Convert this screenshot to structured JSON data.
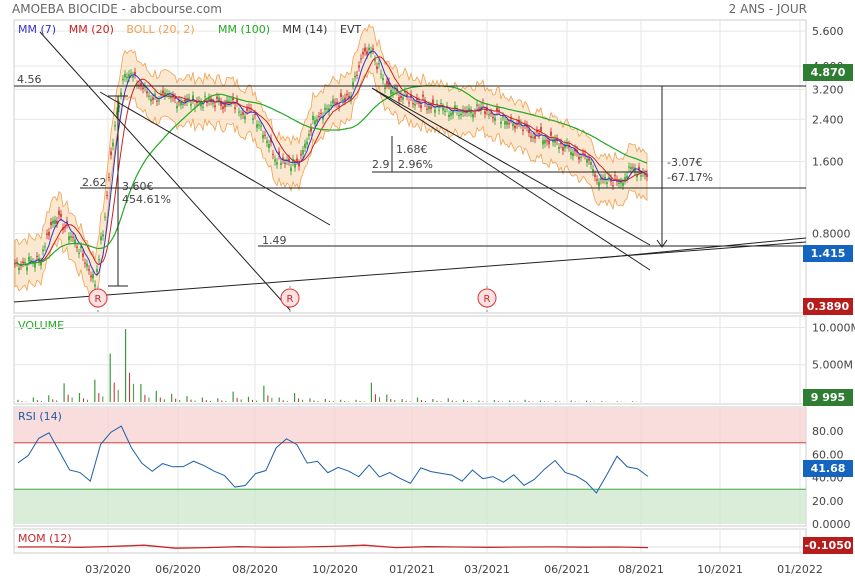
{
  "header": {
    "title": "AMOEBA BIOCIDE - abcbourse.com",
    "period": "2 ANS - JOUR"
  },
  "legend": [
    {
      "text": "MM (7)",
      "color": "#3333cc"
    },
    {
      "text": "MM (20)",
      "color": "#cc2222"
    },
    {
      "text": "BOLL (20, 2)",
      "color": "#f0a050"
    },
    {
      "text": "MM (100)",
      "color": "#22aa22"
    },
    {
      "text": "MM (14)",
      "color": "#333333"
    },
    {
      "text": "EVT",
      "color": "#333333"
    }
  ],
  "badges": {
    "high": {
      "text": "4.870",
      "color": "#2e7d32"
    },
    "last": {
      "text": "1.415",
      "color": "#1565c0"
    },
    "low": {
      "text": "0.3890",
      "color": "#b71c1c"
    },
    "volume": {
      "text": "9 995",
      "color": "#2e7d32"
    },
    "rsi": {
      "text": "41.68",
      "color": "#1565c0"
    },
    "mom": {
      "text": "-0.1050",
      "color": "#b71c1c"
    }
  },
  "panels": {
    "volume": "VOLUME",
    "rsi": "RSI (14)",
    "mom": "MOM (12)"
  },
  "annotations": {
    "level_456": "4.56",
    "level_262": "2.62",
    "level_149": "1.49",
    "move_up_price": "3.60€",
    "move_up_pct": "454.61%",
    "small_price": "1.68€",
    "small_pct": "2.9",
    "small_pct2": "2.96%",
    "big_drop_price": "-3.07€",
    "big_drop_pct": "-67.17%",
    "evt_label": "R"
  },
  "chart_data": [
    {
      "type": "line",
      "title": "AMOEBA BIOCIDE - abcbourse.com",
      "yscale": "log",
      "y_ticks": [
        "0.8000",
        "1.600",
        "2.400",
        "3.200",
        "4.000",
        "5.600"
      ],
      "ylim": [
        0.38,
        6.0
      ],
      "x_ticks": [
        "03/2020",
        "06/2020",
        "08/2020",
        "10/2020",
        "01/2021",
        "03/2021",
        "06/2021",
        "08/2021",
        "10/2021",
        "01/2022"
      ],
      "series": [
        {
          "name": "price",
          "x": [
            "12/2019",
            "01/2020",
            "02/2020",
            "03/2020",
            "04/2020",
            "05/2020",
            "06/2020",
            "07/2020",
            "08/2020",
            "09/2020",
            "10/2020",
            "11/2020",
            "12/2020",
            "01/2021",
            "02/2021",
            "03/2021",
            "04/2021",
            "05/2021",
            "06/2021",
            "07/2021",
            "08/2021"
          ],
          "values": [
            0.6,
            0.7,
            0.85,
            0.55,
            3.9,
            3.3,
            2.9,
            2.9,
            1.9,
            1.6,
            2.8,
            4.5,
            3.1,
            2.85,
            2.6,
            2.7,
            2.1,
            2.0,
            1.5,
            1.35,
            1.415
          ]
        }
      ],
      "annotations": [
        "4.56",
        "2.62",
        "1.49",
        "3.60€",
        "454.61%",
        "1.68€",
        "-3.07€",
        "-67.17%"
      ]
    },
    {
      "type": "bar",
      "title": "VOLUME",
      "y_ticks": [
        "5.000M",
        "10.000M"
      ],
      "ylim": [
        0,
        11
      ],
      "series": [
        {
          "name": "VOLUME",
          "values": [
            0.3,
            0.6,
            0.9,
            2.5,
            1.2,
            3.0,
            6.5,
            9.8,
            2.4,
            1.5,
            1.1,
            0.8,
            0.6,
            0.5,
            1.4,
            0.7,
            2.2,
            0.6,
            1.2,
            0.5,
            0.4,
            0.3,
            0.3,
            2.6,
            1.0,
            0.4,
            0.6,
            0.4,
            0.5,
            0.3,
            0.2,
            0.25,
            0.2,
            0.3,
            0.2,
            0.15,
            0.2,
            0.18,
            0.12,
            0.1,
            0.1
          ]
        }
      ]
    },
    {
      "type": "line",
      "title": "RSI (14)",
      "y_ticks": [
        "0.0000",
        "20.00",
        "40.00",
        "60.00",
        "80.00"
      ],
      "ylim": [
        0,
        100
      ],
      "series": [
        {
          "name": "RSI (14)",
          "values": [
            55,
            62,
            70,
            82,
            60,
            50,
            45,
            40,
            68,
            78,
            85,
            62,
            55,
            48,
            52,
            50,
            47,
            52,
            48,
            44,
            45,
            30,
            35,
            40,
            45,
            62,
            72,
            65,
            55,
            52,
            48,
            50,
            45,
            42,
            48,
            40,
            46,
            42,
            38,
            50,
            44,
            42,
            40,
            35,
            45,
            42,
            38,
            36,
            40,
            34,
            38,
            50,
            52,
            46,
            40,
            36,
            30,
            40,
            55,
            50,
            45,
            41.68
          ]
        }
      ]
    },
    {
      "type": "line",
      "title": "MOM (12)",
      "series": [
        {
          "name": "MOM (12)",
          "values": [
            0,
            0.02,
            -0.05,
            0.1,
            0.3,
            -0.2,
            -0.1,
            0.05,
            -0.05,
            0,
            0.1,
            0.3,
            -0.1,
            0.05,
            0,
            -0.05,
            0,
            0.02,
            -0.03,
            0,
            -0.105
          ]
        }
      ]
    }
  ]
}
